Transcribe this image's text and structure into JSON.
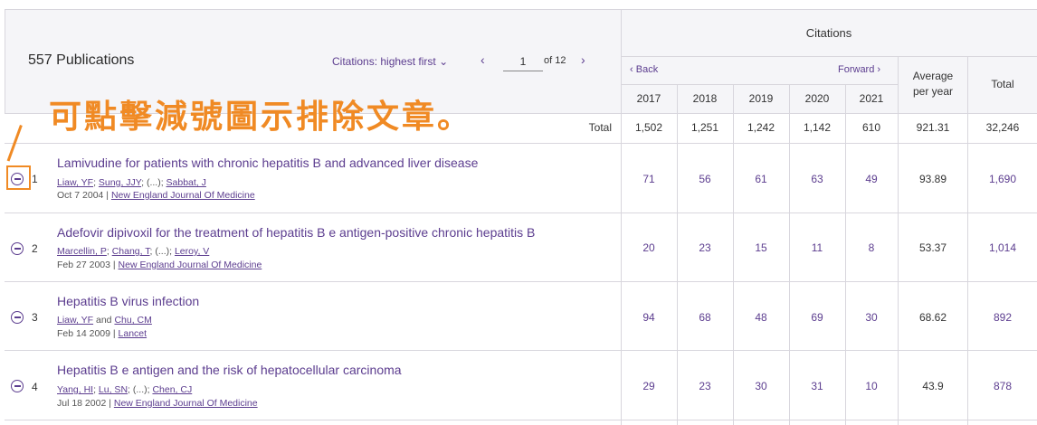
{
  "header": {
    "publication_count": "557 Publications",
    "sort_label": "Citations: highest first",
    "page_current": "1",
    "page_of": "of",
    "page_total": "12",
    "citations_title": "Citations",
    "back_label": "Back",
    "forward_label": "Forward",
    "years": [
      "2017",
      "2018",
      "2019",
      "2020",
      "2021"
    ],
    "average_label_1": "Average",
    "average_label_2": "per year",
    "total_label": "Total"
  },
  "totals": {
    "label": "Total",
    "years": [
      "1,502",
      "1,251",
      "1,242",
      "1,142",
      "610"
    ],
    "average": "921.31",
    "total": "32,246"
  },
  "annotation": {
    "text": "可點擊減號圖示排除文章。"
  },
  "rows": [
    {
      "rank": "1",
      "title": "Lamivudine for patients with chronic hepatitis B and advanced liver disease",
      "authors": [
        "Liaw, YF",
        "Sung, JJY",
        "Sabbat, J"
      ],
      "author_sep_1": ";",
      "author_sep_2": "; (...);",
      "date": "Oct 7 2004",
      "journal": "New England Journal Of Medicine",
      "counts": [
        "71",
        "56",
        "61",
        "63",
        "49"
      ],
      "average": "93.89",
      "total": "1,690"
    },
    {
      "rank": "2",
      "title": "Adefovir dipivoxil for the treatment of hepatitis B e antigen-positive chronic hepatitis B",
      "authors": [
        "Marcellin, P",
        "Chang, T",
        "Leroy, V"
      ],
      "author_sep_1": ";",
      "author_sep_2": "; (...);",
      "date": "Feb 27 2003",
      "journal": "New England Journal Of Medicine",
      "counts": [
        "20",
        "23",
        "15",
        "11",
        "8"
      ],
      "average": "53.37",
      "total": "1,014"
    },
    {
      "rank": "3",
      "title": "Hepatitis B virus infection",
      "authors": [
        "Liaw, YF",
        "Chu, CM"
      ],
      "author_sep_1": "and",
      "date": "Feb 14 2009",
      "journal": "Lancet",
      "counts": [
        "94",
        "68",
        "48",
        "69",
        "30"
      ],
      "average": "68.62",
      "total": "892"
    },
    {
      "rank": "4",
      "title": "Hepatitis B e antigen and the risk of hepatocellular carcinoma",
      "authors": [
        "Yang, HI",
        "Lu, SN",
        "Chen, CJ"
      ],
      "author_sep_1": ";",
      "author_sep_2": "; (...);",
      "date": "Jul 18 2002",
      "journal": "New England Journal Of Medicine",
      "counts": [
        "29",
        "23",
        "30",
        "31",
        "10"
      ],
      "average": "43.9",
      "total": "878"
    }
  ]
}
